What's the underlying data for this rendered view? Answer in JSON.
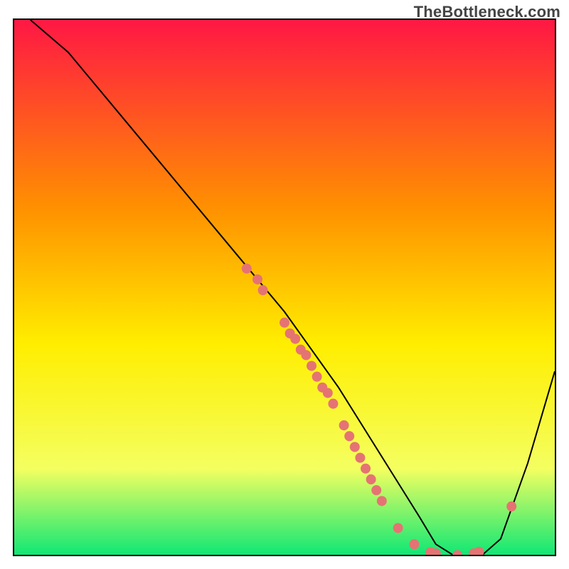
{
  "watermark": "TheBottleneck.com",
  "chart_data": {
    "type": "line",
    "title": "",
    "xlabel": "",
    "ylabel": "",
    "xlim": [
      0,
      100
    ],
    "ylim": [
      0,
      100
    ],
    "grid": false,
    "legend": false,
    "background_gradient": {
      "top": "#ff1744",
      "upper_mid": "#ff9100",
      "mid": "#ffee00",
      "lower_mid": "#f4ff60",
      "bottom": "#00e676"
    },
    "series": [
      {
        "name": "bottleneck-curve",
        "x": [
          3,
          10,
          20,
          30,
          40,
          50,
          55,
          60,
          65,
          70,
          75,
          78,
          82,
          86,
          90,
          95,
          100
        ],
        "y": [
          100,
          94,
          82,
          70,
          58,
          46,
          39,
          32,
          24,
          16,
          8,
          3,
          0.5,
          0.5,
          4,
          18,
          35
        ]
      }
    ],
    "markers": [
      {
        "name": "scatter-left-cluster",
        "x": 43,
        "y": 54
      },
      {
        "name": "scatter-left-cluster",
        "x": 45,
        "y": 52
      },
      {
        "name": "scatter-left-cluster",
        "x": 46,
        "y": 50
      },
      {
        "name": "scatter-mid-cluster",
        "x": 50,
        "y": 44
      },
      {
        "name": "scatter-mid-cluster",
        "x": 51,
        "y": 42
      },
      {
        "name": "scatter-mid-cluster",
        "x": 52,
        "y": 41
      },
      {
        "name": "scatter-mid-cluster",
        "x": 53,
        "y": 39
      },
      {
        "name": "scatter-mid-cluster",
        "x": 54,
        "y": 38
      },
      {
        "name": "scatter-mid-cluster",
        "x": 55,
        "y": 36
      },
      {
        "name": "scatter-mid-cluster",
        "x": 56,
        "y": 34
      },
      {
        "name": "scatter-mid-cluster",
        "x": 57,
        "y": 32
      },
      {
        "name": "scatter-mid-cluster",
        "x": 58,
        "y": 31
      },
      {
        "name": "scatter-mid-cluster",
        "x": 59,
        "y": 29
      },
      {
        "name": "scatter-lower-cluster",
        "x": 61,
        "y": 25
      },
      {
        "name": "scatter-lower-cluster",
        "x": 62,
        "y": 23
      },
      {
        "name": "scatter-lower-cluster",
        "x": 63,
        "y": 21
      },
      {
        "name": "scatter-lower-cluster",
        "x": 64,
        "y": 19
      },
      {
        "name": "scatter-lower-cluster",
        "x": 65,
        "y": 17
      },
      {
        "name": "scatter-lower-cluster",
        "x": 66,
        "y": 15
      },
      {
        "name": "scatter-lower-cluster",
        "x": 67,
        "y": 13
      },
      {
        "name": "scatter-lower-cluster",
        "x": 68,
        "y": 11
      },
      {
        "name": "scatter-valley",
        "x": 71,
        "y": 6
      },
      {
        "name": "scatter-valley",
        "x": 74,
        "y": 3
      },
      {
        "name": "scatter-valley",
        "x": 77,
        "y": 1.5
      },
      {
        "name": "scatter-valley",
        "x": 78,
        "y": 1.3
      },
      {
        "name": "scatter-valley",
        "x": 82,
        "y": 1
      },
      {
        "name": "scatter-valley",
        "x": 85,
        "y": 1.3
      },
      {
        "name": "scatter-valley",
        "x": 86,
        "y": 1.6
      },
      {
        "name": "scatter-right",
        "x": 92,
        "y": 10
      }
    ],
    "marker_style": {
      "color": "#e57373",
      "radius_px": 7
    }
  }
}
